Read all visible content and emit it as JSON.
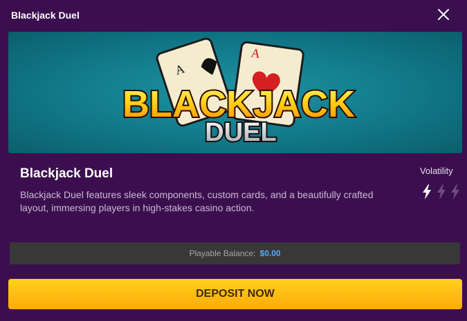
{
  "modal": {
    "title": "Blackjack Duel",
    "close_icon": "close-icon"
  },
  "banner": {
    "logo_line1": "BLACKJACK",
    "logo_line2": "DUEL",
    "card_rank": "A",
    "background_color": "#137e8f"
  },
  "game": {
    "name": "Blackjack Duel",
    "description": "Blackjack Duel features sleek components, custom cards, and a beautifully crafted layout, immersing players in high-stakes casino action."
  },
  "volatility": {
    "label": "Volatility",
    "level": 1,
    "max": 3,
    "icon": "lightning-bolt-icon",
    "active_color": "#ffffff",
    "inactive_color": "#6e4d7e"
  },
  "balance": {
    "label": "Playable Balance:",
    "value": "$0.00"
  },
  "deposit": {
    "label": "DEPOSIT NOW",
    "color": "#ffbe12"
  }
}
